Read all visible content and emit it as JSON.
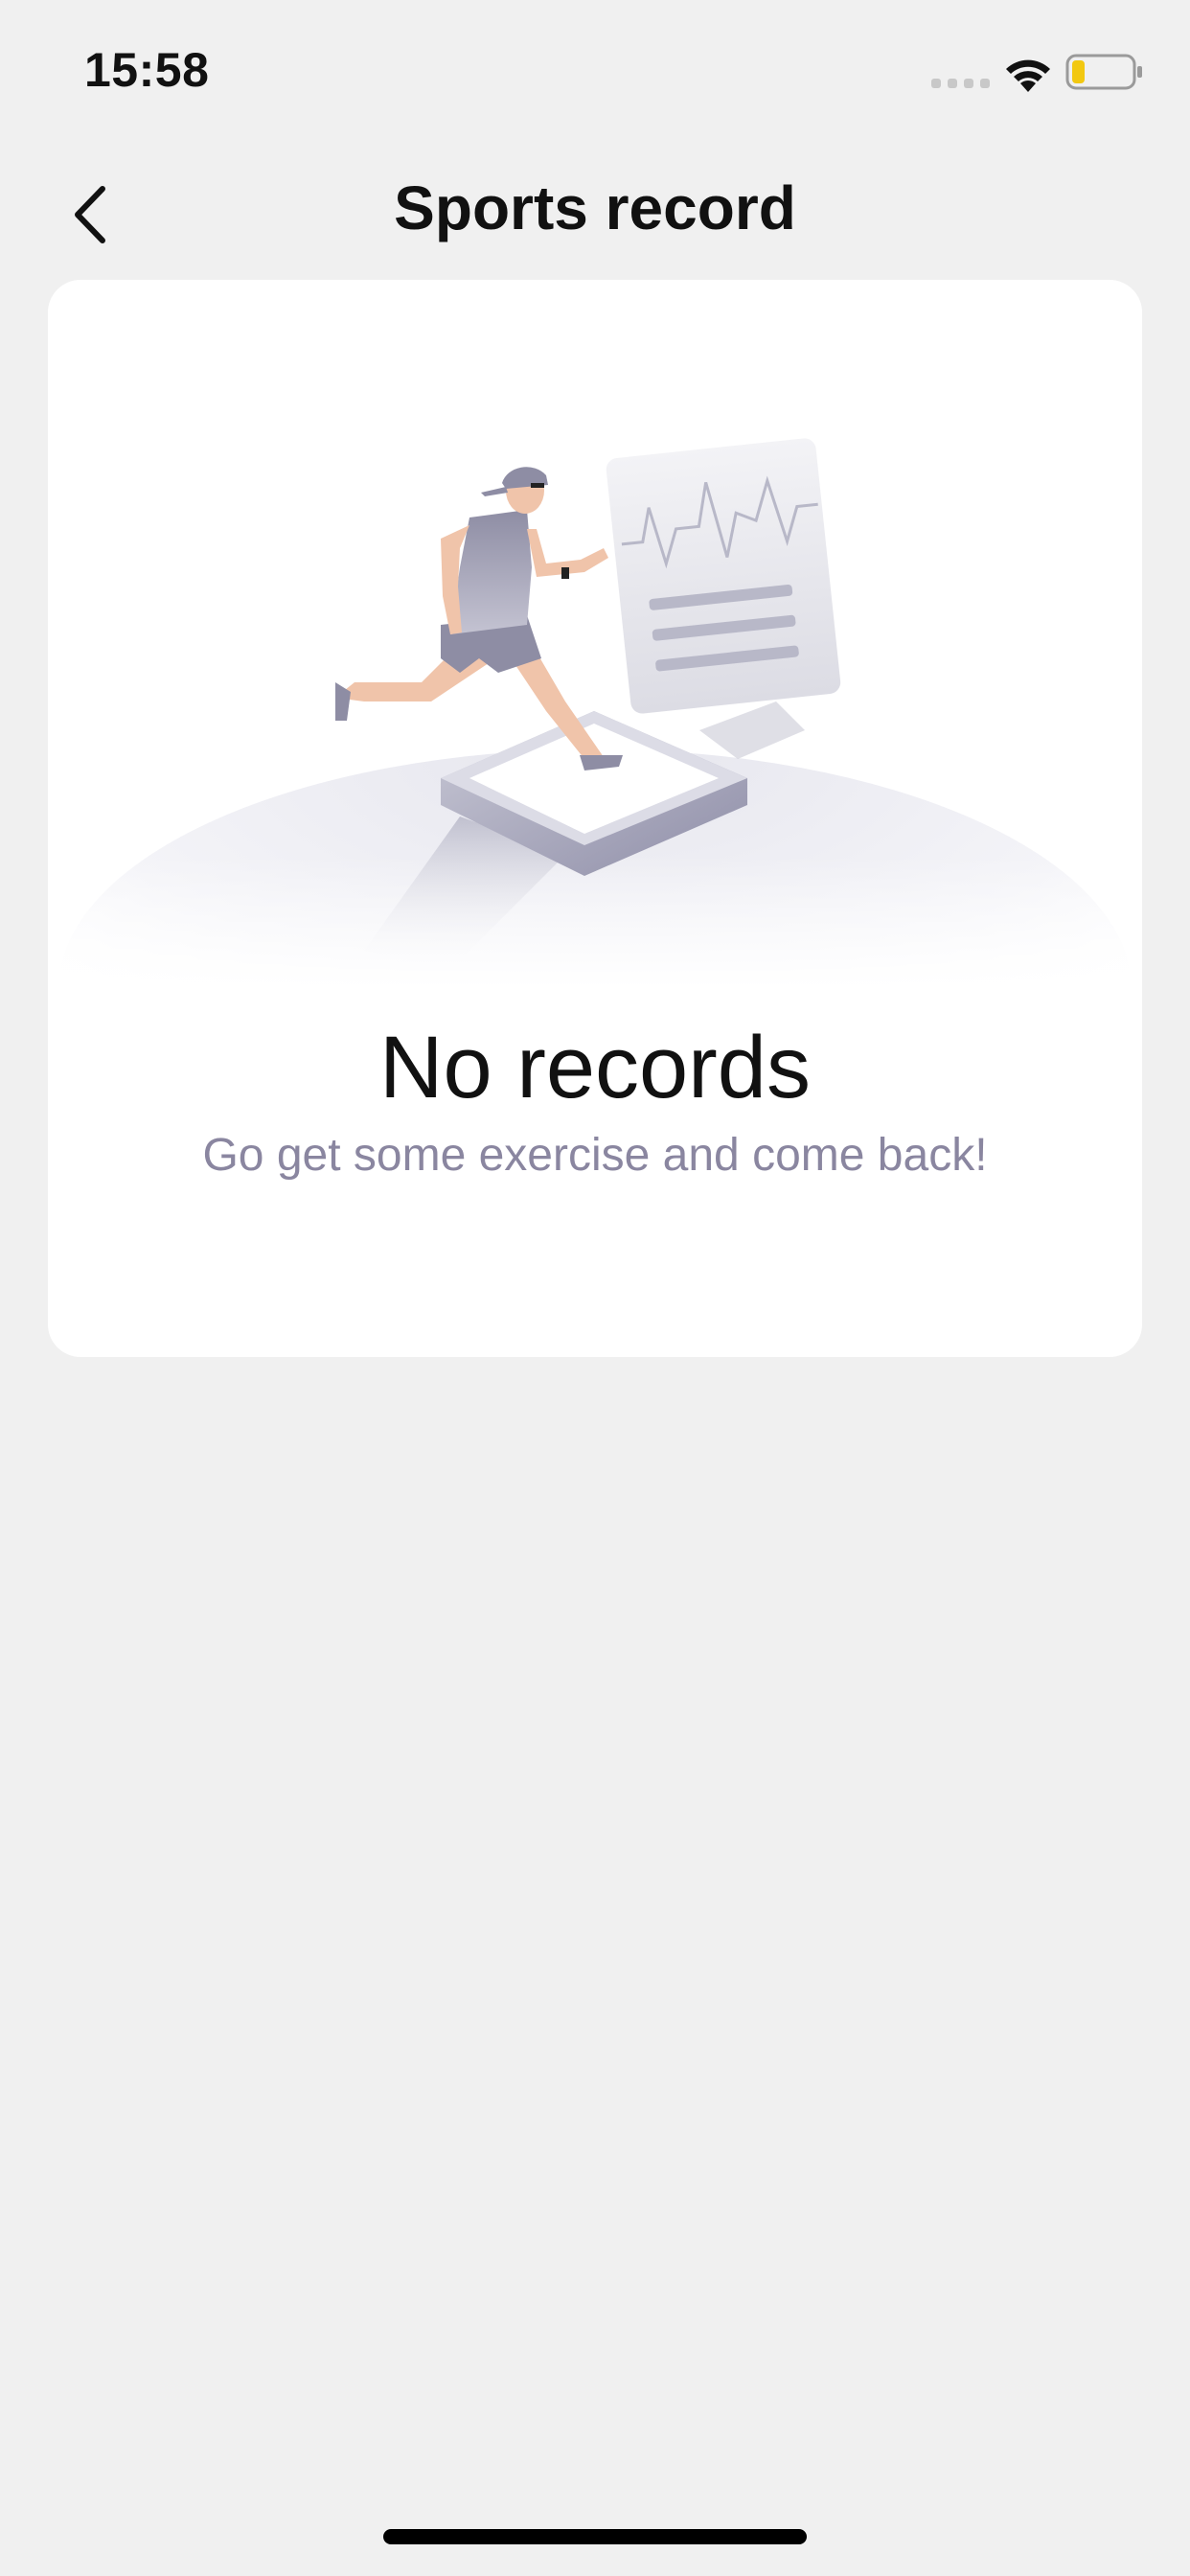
{
  "status_bar": {
    "time": "15:58",
    "icons": [
      "cellular-signal-icon",
      "wifi-icon",
      "battery-icon"
    ],
    "battery_color": "#f2c811"
  },
  "nav": {
    "back_icon": "chevron-left-icon",
    "title": "Sports record"
  },
  "empty_state": {
    "illustration": "runner-on-smartwatch-illustration",
    "title": "No records",
    "subtitle": "Go get some exercise and come back!"
  },
  "colors": {
    "background": "#f0f0f0",
    "card": "#ffffff",
    "subtitle": "#8a86a0",
    "accent_gray": "#9c9bb2"
  }
}
